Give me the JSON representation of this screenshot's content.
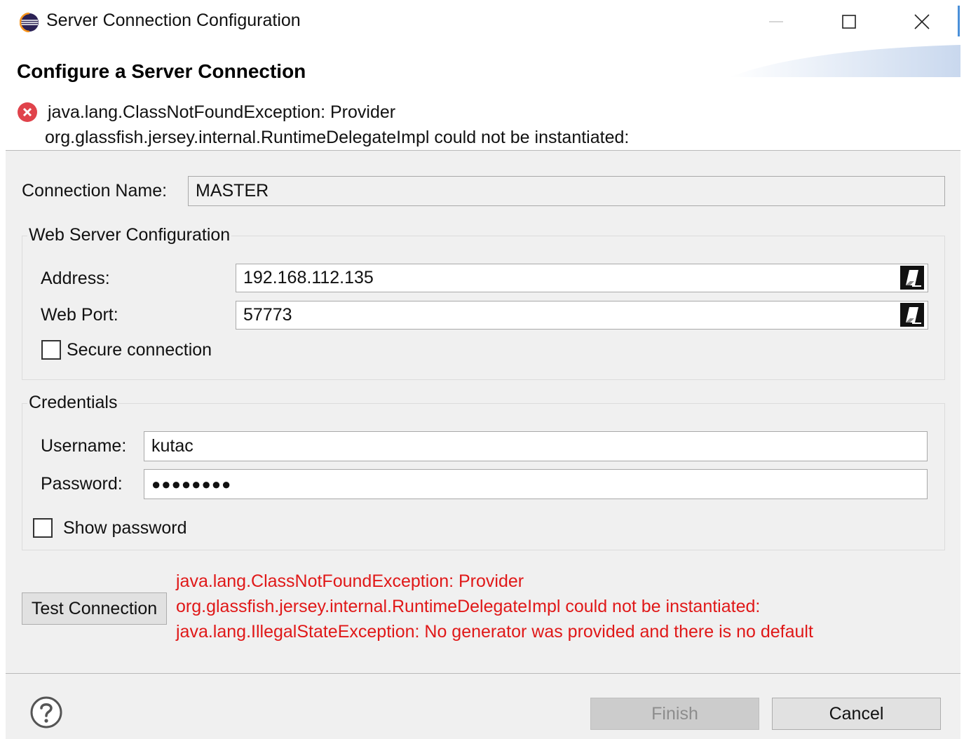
{
  "window": {
    "title": "Server Connection Configuration",
    "icon": "eclipse-icon",
    "controls": [
      "minimize-icon",
      "maximize-icon",
      "close-icon"
    ]
  },
  "header": {
    "title": "Configure a Server Connection",
    "error_icon": "error-icon",
    "error_line1": "java.lang.ClassNotFoundException: Provider",
    "error_line2": "org.glassfish.jersey.internal.RuntimeDelegateImpl could not be instantiated:"
  },
  "connection": {
    "name_label": "Connection Name:",
    "name_value": "MASTER"
  },
  "web_server": {
    "group_title": "Web Server Configuration",
    "address_label": "Address:",
    "address_value": "192.168.112.135",
    "port_label": "Web Port:",
    "port_value": "57773",
    "variable_icon": "variable-edit-icon",
    "secure_label": "Secure connection",
    "secure_checked": false
  },
  "credentials": {
    "group_title": "Credentials",
    "username_label": "Username:",
    "username_value": "kutac",
    "password_label": "Password:",
    "password_value": "●●●●●●●●",
    "show_password_label": "Show password",
    "show_password_checked": false
  },
  "test": {
    "button_label": "Test Connection",
    "error_lines": [
      "java.lang.ClassNotFoundException: Provider",
      "org.glassfish.jersey.internal.RuntimeDelegateImpl could not be instantiated:",
      "java.lang.IllegalStateException: No generator was provided and there is no default"
    ]
  },
  "footer": {
    "help_icon": "help-icon",
    "finish_label": "Finish",
    "finish_enabled": false,
    "cancel_label": "Cancel"
  },
  "colors": {
    "error_text": "#e01818",
    "dialog_bg": "#f0f0f0",
    "accent": "#4a90d9"
  }
}
